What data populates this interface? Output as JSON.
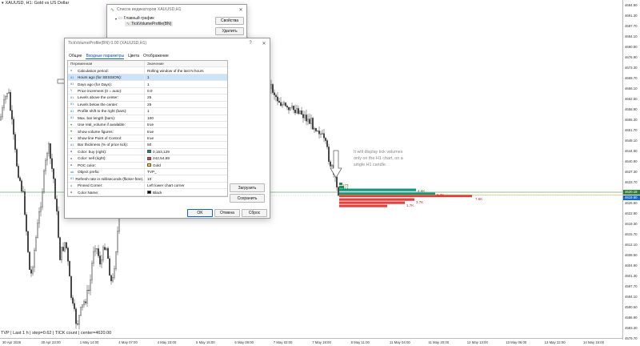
{
  "chart": {
    "symbol_line": "XAUUSD, H1:  Gold vs US Dollar",
    "status_line": "TVP | Last 1 h | step=0.62 | TICK count | center=4620.00",
    "annotation": "It will display tick volumes only on the H1 chart, on a single H1 candle.",
    "price_labels": [
      "4694.90",
      "4691.30",
      "4687.70",
      "4684.10",
      "4680.50",
      "4676.90",
      "4673.30",
      "4669.70",
      "4666.10",
      "4662.50",
      "4658.90",
      "4655.30",
      "4651.70",
      "4648.10",
      "4644.50",
      "4640.90",
      "4637.30",
      "4633.70",
      "4630.10",
      "4626.50",
      "4622.90",
      "4619.30",
      "4615.70",
      "4612.10",
      "4608.50",
      "4604.90",
      "4601.30",
      "4597.70",
      "4594.10",
      "4590.50",
      "4586.90",
      "4583.30",
      "4579.70"
    ],
    "price_tags": [
      {
        "text": "4620.18",
        "color": "#2e7d32"
      },
      {
        "text": "4619.60",
        "color": "#1565c0"
      }
    ],
    "time_labels": [
      "30 Apr 2026",
      "30 Apr 23:00",
      "1 May 14:00",
      "4 May 07:00",
      "4 May 23:00",
      "5 May 16:00",
      "6 May 09:00",
      "7 May 02:00",
      "7 May 18:00",
      "8 May 11:00",
      "11 May 04:00",
      "11 May 20:00",
      "12 May 13:00",
      "13 May 06:00",
      "13 May 22:00",
      "14 May 15:00"
    ],
    "volume_labels": [
      {
        "text": "173",
        "color": "#2e7d32"
      },
      {
        "text": "313",
        "color": "#2e7d32"
      },
      {
        "text": "4.6K",
        "color": "#2e7d32"
      },
      {
        "text": "5.7K",
        "color": "#c62828"
      },
      {
        "text": "7.6K",
        "color": "#c62828"
      },
      {
        "text": "3.7K",
        "color": "#c62828"
      },
      {
        "text": "1.7K",
        "color": "#c62828"
      }
    ]
  },
  "indicators_window": {
    "title": "Список индикаторов XAUUSD,H1",
    "tree_root": "Главный график",
    "tree_item": "TickVolumeProfile(BN)",
    "properties_button": "Свойства",
    "delete_button": "Удалить"
  },
  "dialog": {
    "title": "TickVolumeProfile(BN) 0.00 (XAUUSD,H1)",
    "tabs": [
      "Общие",
      "Входные параметры",
      "Цвета",
      "Отображение"
    ],
    "col_variable": "Переменная",
    "col_value": "Значение",
    "rows": [
      {
        "icon": "gear",
        "name": "Calculation period:",
        "value": "Rolling window of the last N hours"
      },
      {
        "icon": "123",
        "name": "Hours ago (for SESSION):",
        "value": "1"
      },
      {
        "icon": "123",
        "name": "Days ago (for Days):",
        "value": "1"
      },
      {
        "icon": "1/2",
        "name": "Price increment (0 = auto):",
        "value": "0.0"
      },
      {
        "icon": "123",
        "name": "Levels above the center:",
        "value": "25"
      },
      {
        "icon": "123",
        "name": "Levels below the center:",
        "value": "25"
      },
      {
        "icon": "123",
        "name": "Profile shift to the right (bars):",
        "value": "1"
      },
      {
        "icon": "123",
        "name": "Max. bar length (bars):",
        "value": "100"
      },
      {
        "icon": "flag",
        "name": "Use real_volume if available:",
        "value": "true"
      },
      {
        "icon": "flag",
        "name": "Show volume figures:",
        "value": "true"
      },
      {
        "icon": "flag",
        "name": "Show line Point of Control:",
        "value": "true"
      },
      {
        "icon": "123",
        "name": "Bar thickness (% of price tick):",
        "value": "50"
      },
      {
        "icon": "color",
        "name": "Color: buy (right):",
        "value": "0,153,129",
        "swatch": "#009981"
      },
      {
        "icon": "color",
        "name": "Color: sell (right):",
        "value": "242,54,69",
        "swatch": "#f23645"
      },
      {
        "icon": "color",
        "name": "POC color:",
        "value": "Gold",
        "swatch": "#ffd700"
      },
      {
        "icon": "abc",
        "name": "Object prefix:",
        "value": "TVP_"
      },
      {
        "icon": "123",
        "name": "Refresh rate in milliseconds (flicker-free)...",
        "value": "10"
      },
      {
        "icon": "gear",
        "name": "Pinned Corner:",
        "value": "Left lower chart corner"
      },
      {
        "icon": "color",
        "name": "Color Name:",
        "value": "Black",
        "swatch": "#000000"
      }
    ],
    "load_button": "Загрузить",
    "save_button": "Сохранить",
    "ok_button": "OK",
    "cancel_button": "Отмена",
    "reset_button": "Сброс"
  }
}
